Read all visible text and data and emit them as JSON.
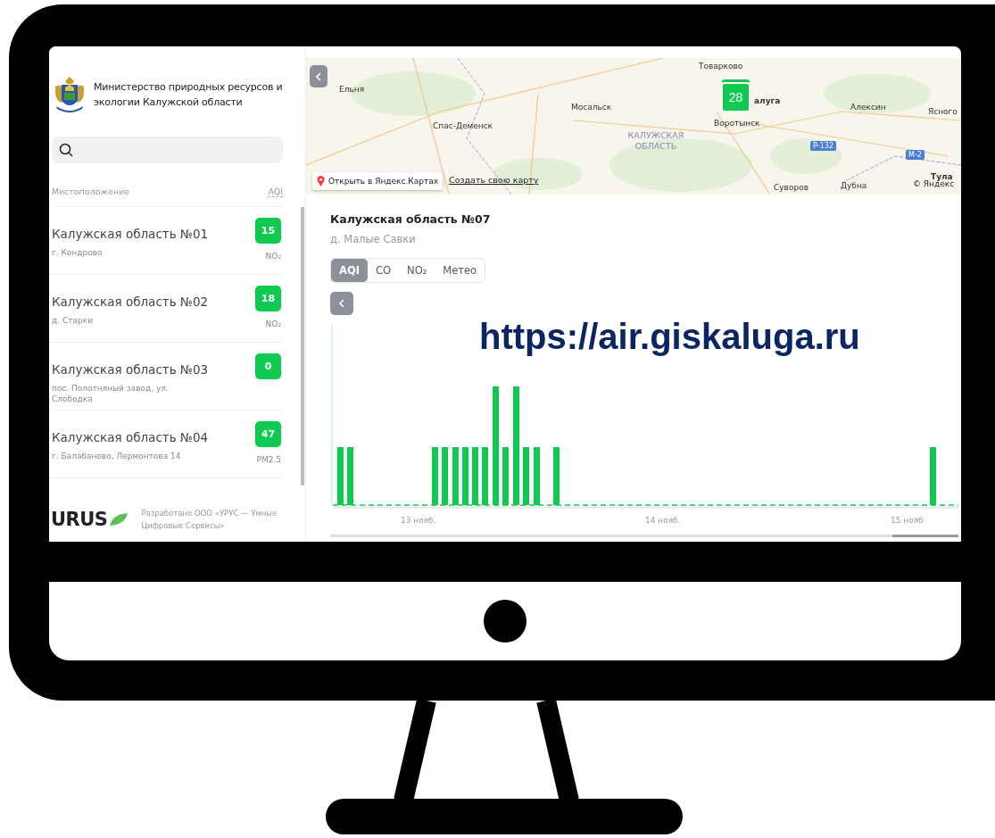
{
  "overlay_caption": "https://air.giskaluga.ru",
  "sidebar": {
    "organization": "Министерство природных ресурсов и экологии Калужской области",
    "list_header": {
      "location": "Местоположение",
      "aqi": "AQI"
    },
    "stations": [
      {
        "name": "Калужская область №01",
        "address": "г. Кондрово",
        "aqi": "15",
        "pollutant": "NO₂"
      },
      {
        "name": "Калужская область №02",
        "address": "д. Старки",
        "aqi": "18",
        "pollutant": "NO₂"
      },
      {
        "name": "Калужская область №03",
        "address": "пос. Полотняный завод, ул. Слободка",
        "aqi": "0"
      },
      {
        "name": "Калужская область №04",
        "address": "г. Балабаново, Лермонтова 14",
        "aqi": "47",
        "pollutant": "PM2.5"
      }
    ],
    "footer": {
      "logo": "URUS",
      "credit": "Разработано ООО «УРУС — Умные Цифровые Сервисы»"
    }
  },
  "map": {
    "labels": [
      {
        "text": "Товарково",
        "kind": "town"
      },
      {
        "text": "Ельня",
        "kind": "town"
      },
      {
        "text": "Мосальск",
        "kind": "town"
      },
      {
        "text": "алуга",
        "kind": "city"
      },
      {
        "text": "Алексин",
        "kind": "town"
      },
      {
        "text": "Ясного",
        "kind": "town"
      },
      {
        "text": "Спас-Деменск",
        "kind": "town"
      },
      {
        "text": "Воротынск",
        "kind": "town"
      },
      {
        "text": "КАЛУЖСКАЯ ОБЛАСТЬ",
        "kind": "region"
      },
      {
        "text": "Р-132",
        "kind": "road"
      },
      {
        "text": "М-2",
        "kind": "road"
      },
      {
        "text": "Тула",
        "kind": "city"
      },
      {
        "text": "Дубна",
        "kind": "town"
      },
      {
        "text": "Суворов",
        "kind": "town"
      }
    ],
    "cluster": "28",
    "open_button": "Открыть в Яндекс.Картах",
    "create_link": "Создать свою карту",
    "copyright": "© Яндекс"
  },
  "detail": {
    "title": "Калужская область №07",
    "subtitle": "д. Малые Савки",
    "tabs": [
      {
        "label": "AQI",
        "selected": true
      },
      {
        "label": "CO",
        "selected": false
      },
      {
        "label": "NO₂",
        "selected": false
      },
      {
        "label": "Метео",
        "selected": false
      }
    ],
    "axis_labels": [
      "13 нояб.",
      "14 нояб.",
      "15 нояб."
    ]
  }
}
